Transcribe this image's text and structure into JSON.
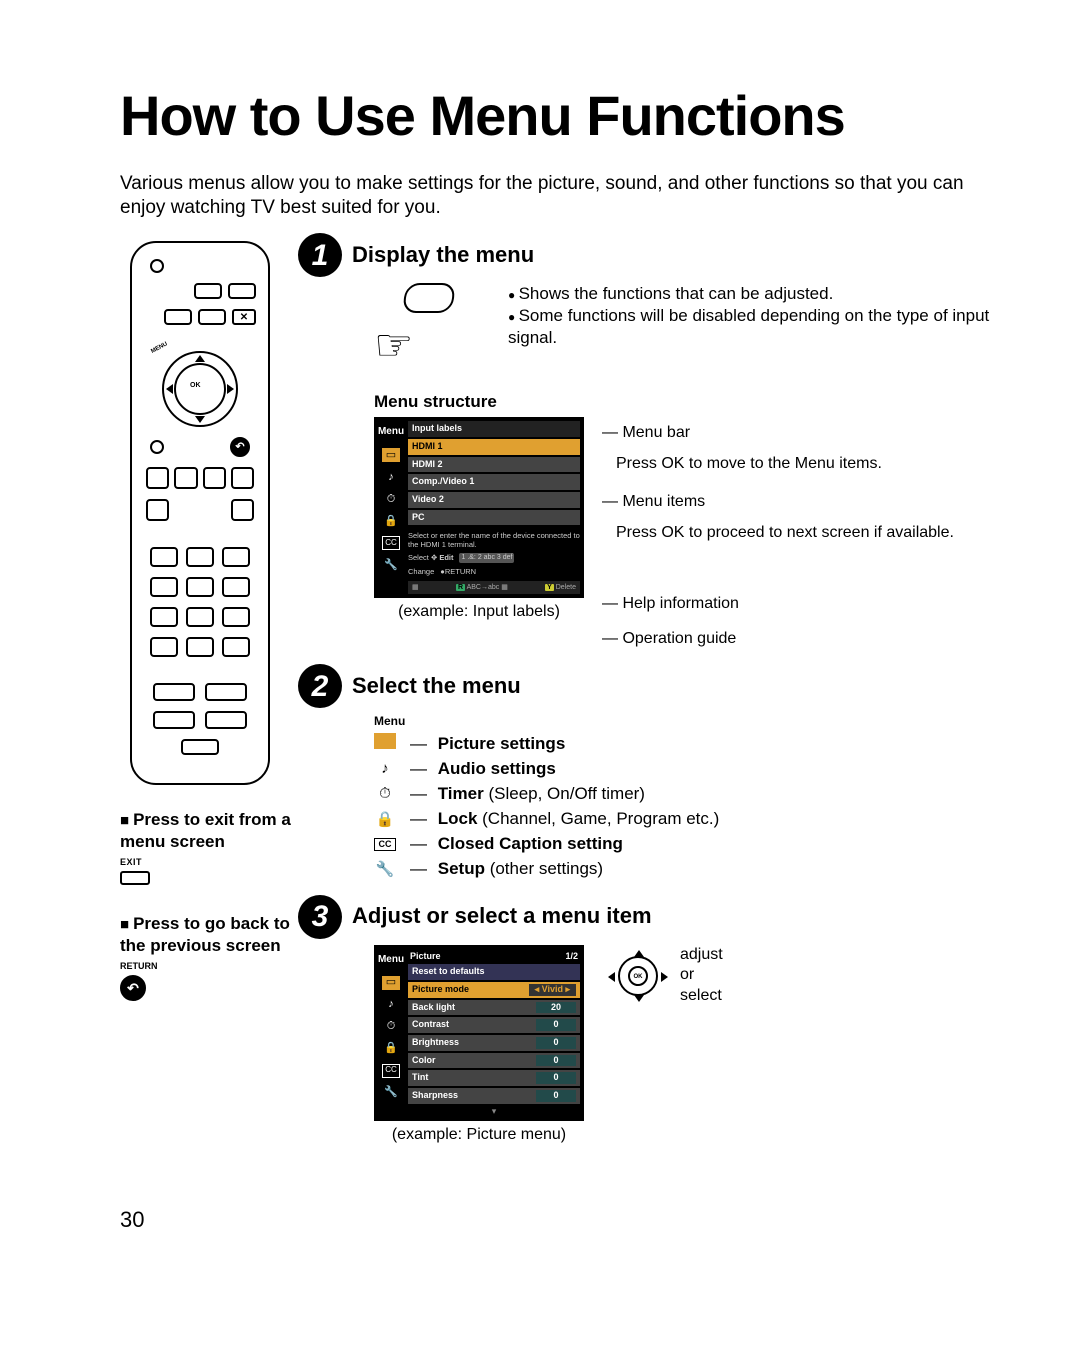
{
  "page_number": "30",
  "title": "How to Use Menu Functions",
  "intro": "Various menus allow you to make settings for the picture, sound, and other functions so that you can enjoy watching TV best suited for you.",
  "step1": {
    "num": "1",
    "title": "Display the menu",
    "bullets": [
      "Shows the functions that can be adjusted.",
      "Some functions will be disabled depending on the type of input signal."
    ],
    "structure_label": "Menu structure",
    "tv": {
      "menu_label": "Menu",
      "header": "Input labels",
      "items": [
        "HDMI 1",
        "HDMI 2",
        "Comp./Video 1",
        "Video 2",
        "PC"
      ],
      "help": "Select or enter the name of the device connected to the HDMI 1 terminal.",
      "op_select": "Select",
      "op_change": "Change",
      "op_edit": "Edit",
      "op_return": "RETURN",
      "footer_abc": "ABC→abc",
      "footer_delete": "Delete",
      "footer_r": "R",
      "footer_y": "Y"
    },
    "annotations": {
      "a1": "Menu bar",
      "a1b": "Press OK to move to the Menu items.",
      "a2": "Menu items",
      "a2b": "Press OK to proceed to next screen if available.",
      "a3": "Help information",
      "a4": "Operation guide"
    },
    "example": "(example: Input labels)"
  },
  "step2": {
    "num": "2",
    "title": "Select the menu",
    "menu_label": "Menu",
    "items": [
      {
        "bold": "Picture settings",
        "rest": ""
      },
      {
        "bold": "Audio settings",
        "rest": ""
      },
      {
        "bold": "Timer",
        "rest": " (Sleep, On/Off timer)"
      },
      {
        "bold": "Lock",
        "rest": " (Channel, Game, Program etc.)"
      },
      {
        "bold": "Closed Caption setting",
        "rest": ""
      },
      {
        "bold": "Setup",
        "rest": " (other settings)"
      }
    ]
  },
  "step3": {
    "num": "3",
    "title": "Adjust or select a menu item",
    "tv": {
      "menu_label": "Menu",
      "header": "Picture",
      "page": "1/2",
      "reset": "Reset to defaults",
      "rows": [
        {
          "label": "Picture mode",
          "val": "Vivid",
          "sel": true,
          "arrows": true
        },
        {
          "label": "Back light",
          "val": "20"
        },
        {
          "label": "Contrast",
          "val": "0"
        },
        {
          "label": "Brightness",
          "val": "0"
        },
        {
          "label": "Color",
          "val": "0"
        },
        {
          "label": "Tint",
          "val": "0"
        },
        {
          "label": "Sharpness",
          "val": "0"
        }
      ]
    },
    "ctrl": "adjust\nor\nselect",
    "example": "(example: Picture menu)"
  },
  "left_hints": {
    "exit_title": "Press to exit from a menu screen",
    "exit_label": "EXIT",
    "back_title": "Press to go back to the previous screen",
    "return_label": "RETURN"
  },
  "remote": {
    "ok": "OK",
    "menu": "MENU"
  }
}
